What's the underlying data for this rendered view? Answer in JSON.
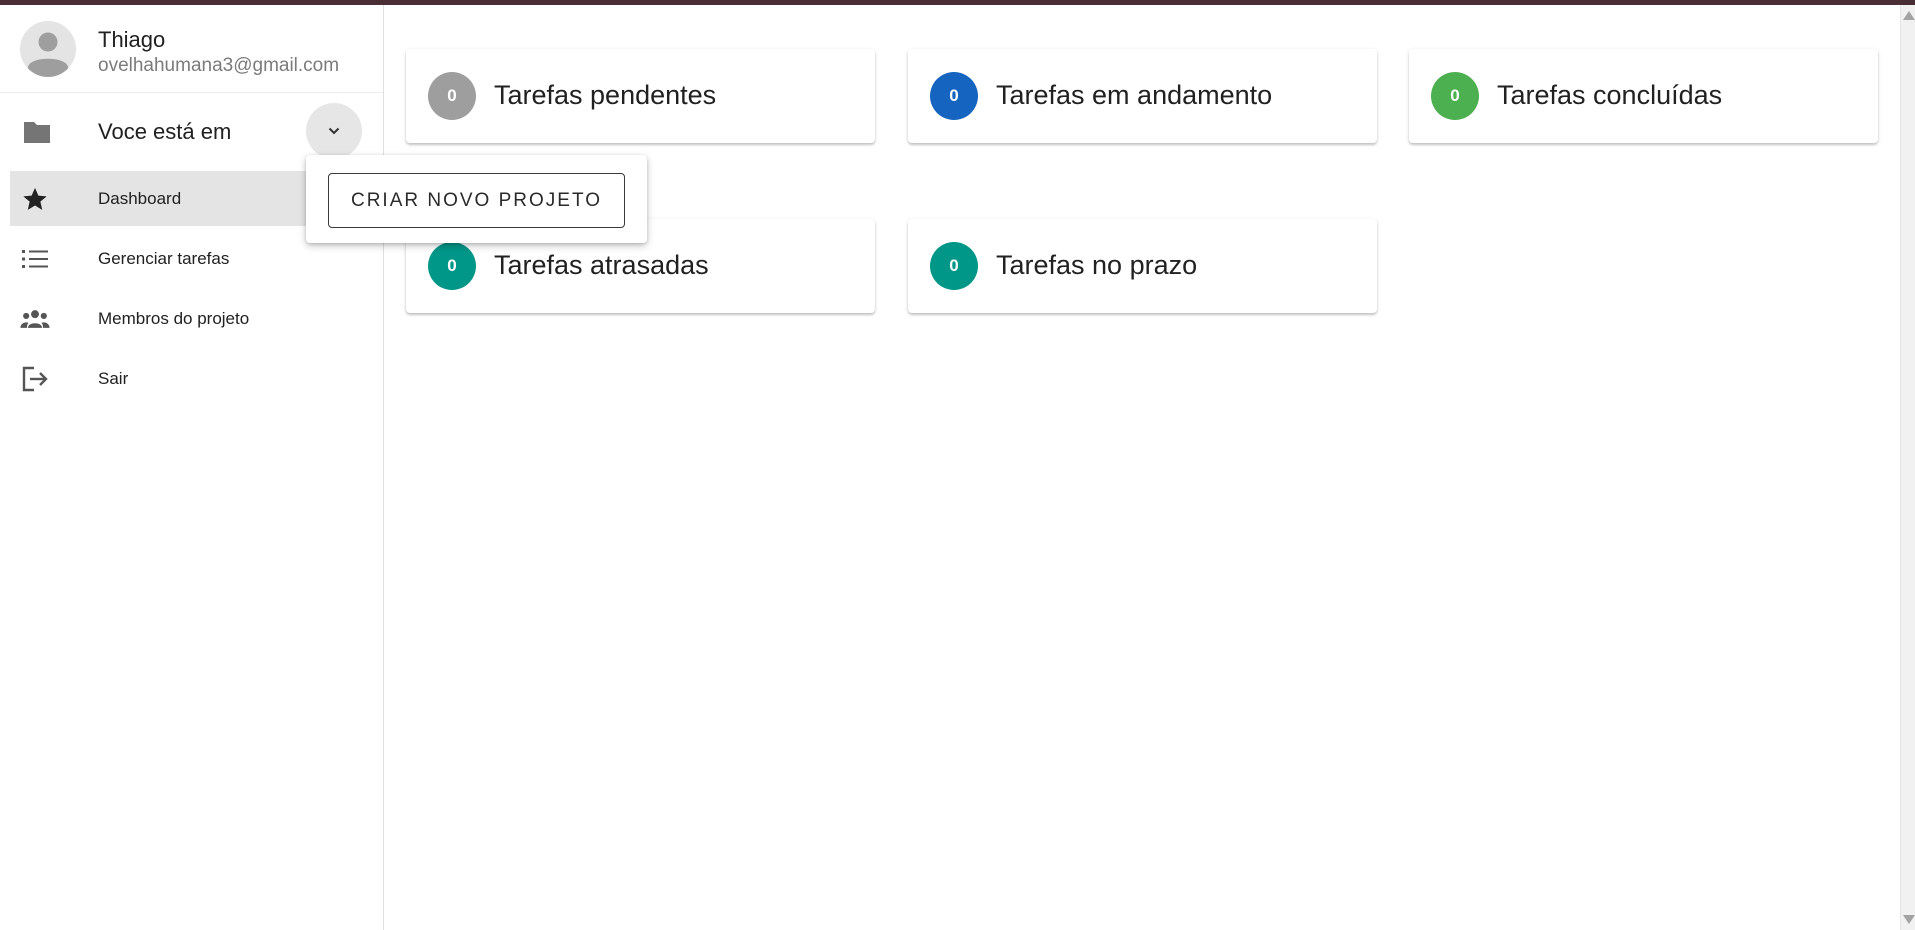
{
  "user": {
    "name": "Thiago",
    "email": "ovelhahumana3@gmail.com"
  },
  "project": {
    "label": "Voce está em"
  },
  "menu": {
    "create_project_label": "CRIAR NOVO PROJETO"
  },
  "nav": {
    "items": [
      {
        "label": "Dashboard",
        "icon": "star-icon",
        "active": true
      },
      {
        "label": "Gerenciar tarefas",
        "icon": "list-icon",
        "active": false
      },
      {
        "label": "Membros do projeto",
        "icon": "people-icon",
        "active": false
      },
      {
        "label": "Sair",
        "icon": "logout-icon",
        "active": false
      }
    ]
  },
  "cards": [
    {
      "count": "0",
      "label": "Tarefas pendentes",
      "color": "#9e9e9e"
    },
    {
      "count": "0",
      "label": "Tarefas em andamento",
      "color": "#1565c0"
    },
    {
      "count": "0",
      "label": "Tarefas concluídas",
      "color": "#4caf50"
    },
    {
      "count": "0",
      "label": "Tarefas atrasadas",
      "color": "#009688"
    },
    {
      "count": "0",
      "label": "Tarefas no prazo",
      "color": "#009688"
    }
  ],
  "colors": {
    "top_bar": "#4a2e35",
    "active_nav_bg": "#e4e4e4"
  }
}
